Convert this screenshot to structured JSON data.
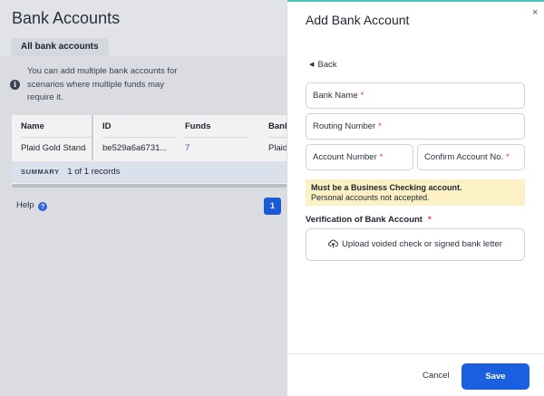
{
  "page": {
    "title": "Bank Accounts",
    "tab": "All bank accounts",
    "info_text": "You can add multiple bank accounts for scenarios where multiple funds may require it."
  },
  "table": {
    "columns": [
      "Name",
      "ID",
      "Funds",
      "Bank"
    ],
    "rows": [
      {
        "name": "Plaid Gold Standard",
        "id": "be529a6a6731...",
        "funds": "7",
        "bank": "Plaid"
      }
    ],
    "summary_label": "SUMMARY",
    "summary_text": "1 of 1 records"
  },
  "help": {
    "label": "Help",
    "icon": "?"
  },
  "pagination": {
    "current_page": "1"
  },
  "drawer": {
    "title": "Add Bank Account",
    "close_icon": "×",
    "back_label": "Back",
    "fields": {
      "bank_name": "Bank Name",
      "routing_number": "Routing Number",
      "account_number": "Account Number",
      "confirm_account": "Confirm Account No."
    },
    "required_mark": "*",
    "warning_bold": "Must be a Business Checking account.",
    "warning_text": "Personal accounts not accepted.",
    "verification_label": "Verification of Bank Account",
    "upload_label": "Upload voided check or signed bank letter",
    "cancel_label": "Cancel",
    "save_label": "Save"
  },
  "colors": {
    "accent": "#1a5fe0",
    "required": "#e0344a",
    "warning_bg": "#fbf1c5",
    "drawer_top": "#4fc3b7"
  }
}
